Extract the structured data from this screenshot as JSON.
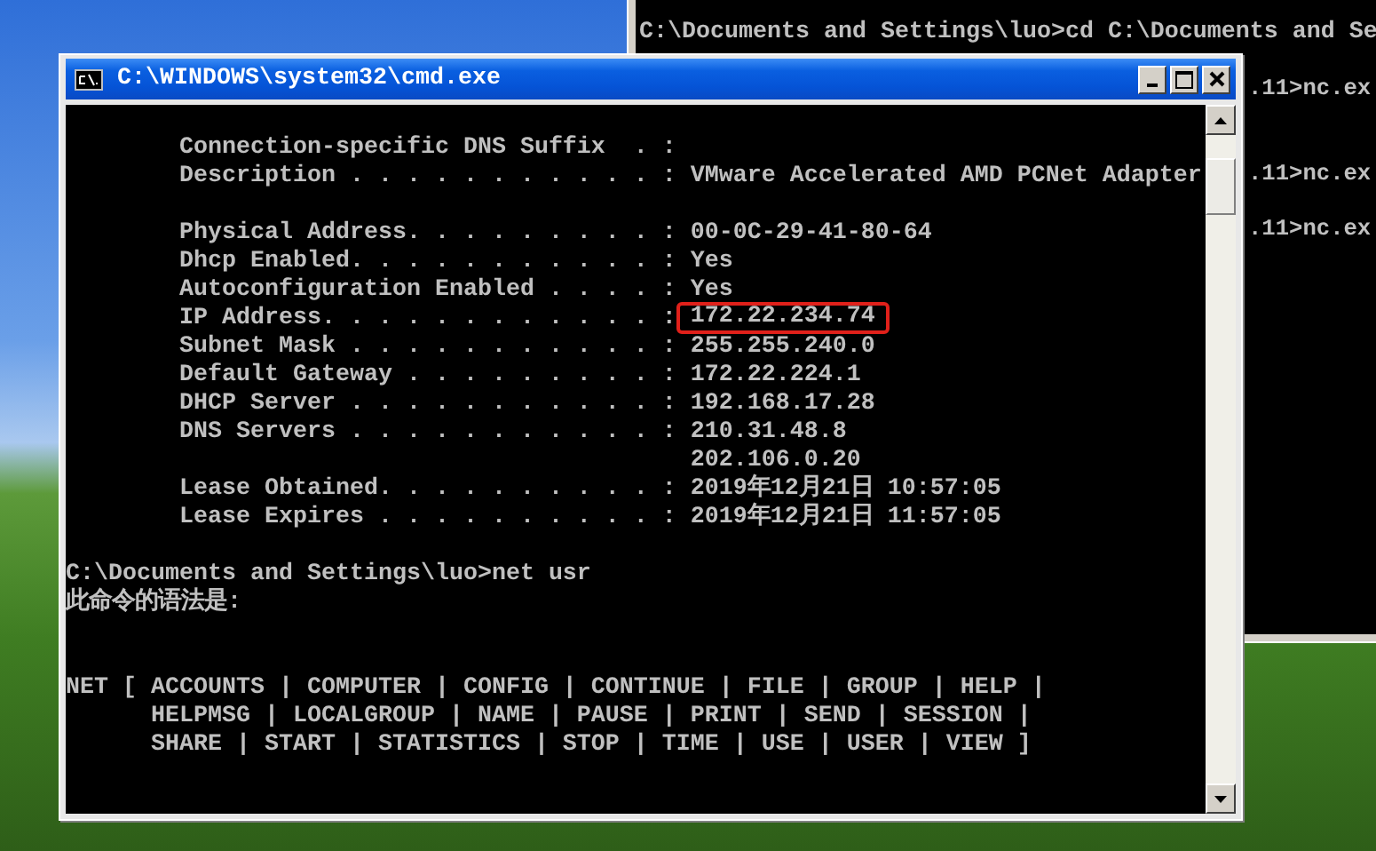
{
  "back_window": {
    "first_line": "C:\\Documents and Settings\\luo>cd C:\\Documents and Se",
    "fragments": [
      ".11>nc.ex",
      ".11>nc.ex",
      ".11>nc.ex"
    ]
  },
  "window": {
    "title": "C:\\WINDOWS\\system32\\cmd.exe",
    "blocks": [
      {
        "lines": [
          {
            "text": "        Connection-specific DNS Suffix  . :"
          },
          {
            "text": "        Description . . . . . . . . . . . : VMware Accelerated AMD PCNet Adapter"
          }
        ]
      },
      {
        "lines": [
          {
            "text": "        Physical Address. . . . . . . . . : 00-0C-29-41-80-64"
          },
          {
            "text": "        Dhcp Enabled. . . . . . . . . . . : Yes"
          },
          {
            "text": "        Autoconfiguration Enabled . . . . : Yes"
          },
          {
            "text": "        IP Address. . . . . . . . . . . . : ",
            "boxed": "172.22.234.74"
          },
          {
            "text": "        Subnet Mask . . . . . . . . . . . : 255.255.240.0"
          },
          {
            "text": "        Default Gateway . . . . . . . . . : 172.22.224.1"
          },
          {
            "text": "        DHCP Server . . . . . . . . . . . : 192.168.17.28"
          },
          {
            "text": "        DNS Servers . . . . . . . . . . . : 210.31.48.8"
          },
          {
            "text": "                                            202.106.0.20"
          },
          {
            "text": "        Lease Obtained. . . . . . . . . . : 2019年12月21日 10:57:05"
          },
          {
            "text": "        Lease Expires . . . . . . . . . . : 2019年12月21日 11:57:05"
          }
        ]
      },
      {
        "lines": [
          {
            "text": "C:\\Documents and Settings\\luo>net usr"
          },
          {
            "text": "此命令的语法是:"
          }
        ]
      },
      {
        "lines": [
          {
            "text": "NET [ ACCOUNTS | COMPUTER | CONFIG | CONTINUE | FILE | GROUP | HELP |"
          },
          {
            "text": "      HELPMSG | LOCALGROUP | NAME | PAUSE | PRINT | SEND | SESSION |"
          },
          {
            "text": "      SHARE | START | STATISTICS | STOP | TIME | USE | USER | VIEW ]"
          }
        ]
      }
    ]
  }
}
